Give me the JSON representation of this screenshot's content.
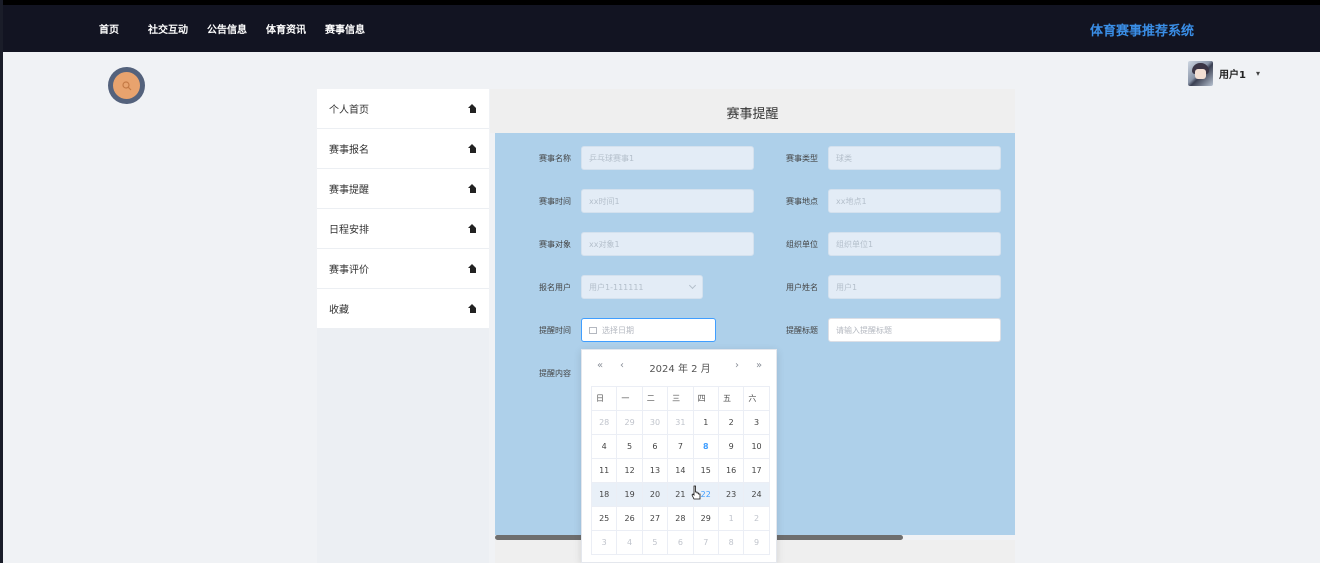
{
  "nav": {
    "items": [
      "首页",
      "社交互动",
      "公告信息",
      "体育资讯",
      "赛事信息"
    ],
    "brand": "体育赛事推荐系统"
  },
  "user": {
    "name": "用户1",
    "caret": "▾"
  },
  "sidebar": {
    "items": [
      "个人首页",
      "赛事报名",
      "赛事提醒",
      "日程安排",
      "赛事评价",
      "收藏"
    ]
  },
  "page": {
    "title": "赛事提醒"
  },
  "form": {
    "event_name_label": "赛事名称",
    "event_name_value": "乒乓球赛事1",
    "event_type_label": "赛事类型",
    "event_type_value": "球类",
    "event_time_label": "赛事时间",
    "event_time_value": "xx时间1",
    "event_place_label": "赛事地点",
    "event_place_value": "xx地点1",
    "event_target_label": "赛事对象",
    "event_target_value": "xx对象1",
    "organizer_label": "组织单位",
    "organizer_value": "组织单位1",
    "signup_user_label": "报名用户",
    "signup_user_value": "用户1-111111",
    "user_name_label": "用户姓名",
    "user_name_value": "用户1",
    "remind_time_label": "提醒时间",
    "remind_time_placeholder": "选择日期",
    "remind_title_label": "提醒标题",
    "remind_title_placeholder": "请输入提醒标题",
    "remind_content_label": "提醒内容"
  },
  "datepicker": {
    "title": "2024 年  2 月",
    "prev_year": "«",
    "prev_month": "‹",
    "next_month": "›",
    "next_year": "»",
    "weekdays": [
      "日",
      "一",
      "二",
      "三",
      "四",
      "五",
      "六"
    ],
    "rows": [
      [
        "28",
        "29",
        "30",
        "31",
        "1",
        "2",
        "3"
      ],
      [
        "4",
        "5",
        "6",
        "7",
        "8",
        "9",
        "10"
      ],
      [
        "11",
        "12",
        "13",
        "14",
        "15",
        "16",
        "17"
      ],
      [
        "18",
        "19",
        "20",
        "21",
        "22",
        "23",
        "24"
      ],
      [
        "25",
        "26",
        "27",
        "28",
        "29",
        "1",
        "2"
      ],
      [
        "3",
        "4",
        "5",
        "6",
        "7",
        "8",
        "9"
      ]
    ],
    "today": "8",
    "hover_row": 3,
    "hover_day": "22"
  },
  "colors": {
    "topbar": "#121422",
    "brand": "#3a8ee6",
    "panel": "#aed0ea",
    "accent": "#409eff"
  }
}
